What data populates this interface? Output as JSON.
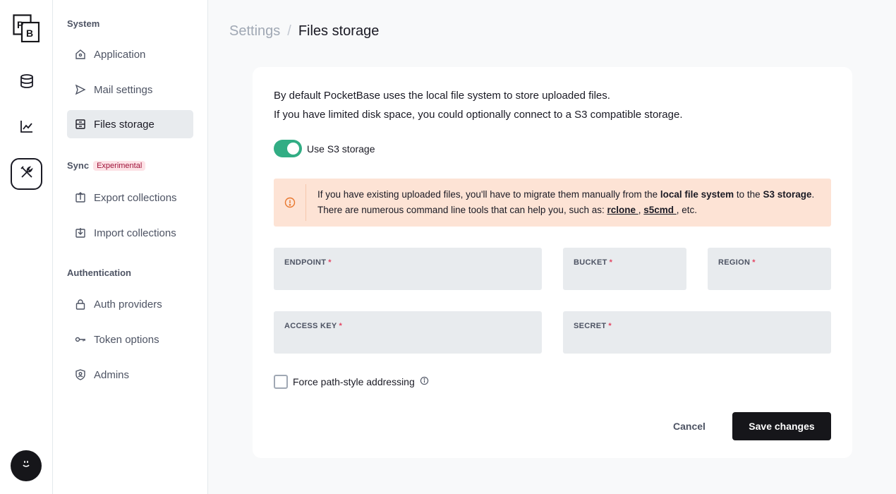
{
  "rail": {
    "logo_text": "PB",
    "items": [
      {
        "icon": "database-icon"
      },
      {
        "icon": "chart-line-icon"
      },
      {
        "icon": "tools-icon"
      }
    ],
    "avatar_icon": "smiley-icon"
  },
  "sidebar": {
    "sections": {
      "system": "System",
      "sync": "Sync",
      "sync_badge": "Experimental",
      "authentication": "Authentication"
    },
    "items": [
      {
        "label": "Application",
        "icon": "home-icon"
      },
      {
        "label": "Mail settings",
        "icon": "send-icon"
      },
      {
        "label": "Files storage",
        "icon": "archive-icon",
        "active": true
      },
      {
        "label": "Export collections",
        "icon": "export-icon"
      },
      {
        "label": "Import collections",
        "icon": "import-icon"
      },
      {
        "label": "Auth providers",
        "icon": "lock-icon"
      },
      {
        "label": "Token options",
        "icon": "key-icon"
      },
      {
        "label": "Admins",
        "icon": "shield-user-icon"
      }
    ]
  },
  "breadcrumb": {
    "parent": "Settings",
    "separator": "/",
    "current": "Files storage"
  },
  "panel": {
    "intro_line1": "By default PocketBase uses the local file system to store uploaded files.",
    "intro_line2": "If you have limited disk space, you could optionally connect to a S3 compatible storage.",
    "toggle_label": "Use S3 storage",
    "toggle_on": true,
    "alert": {
      "t1": "If you have existing uploaded files, you'll have to migrate them manually from the ",
      "b1": "local file system",
      "t2": " to the ",
      "b2": "S3 storage",
      "t3": ".",
      "t4": "There are numerous command line tools that can help you, such as: ",
      "link1": "rclone ",
      "comma": ", ",
      "link2": "s5cmd ",
      "t5": ", etc."
    },
    "fields": {
      "endpoint": {
        "label": "ENDPOINT",
        "value": ""
      },
      "bucket": {
        "label": "BUCKET",
        "value": ""
      },
      "region": {
        "label": "REGION",
        "value": ""
      },
      "access_key": {
        "label": "ACCESS KEY",
        "value": ""
      },
      "secret": {
        "label": "SECRET",
        "value": ""
      },
      "required_mark": "*"
    },
    "force_path_label": "Force path-style addressing",
    "cancel_label": "Cancel",
    "save_label": "Save changes"
  },
  "colors": {
    "accent_toggle": "#32ad84",
    "alert_bg": "#fde3d5",
    "primary_button": "#16161a",
    "required": "#e34562"
  }
}
